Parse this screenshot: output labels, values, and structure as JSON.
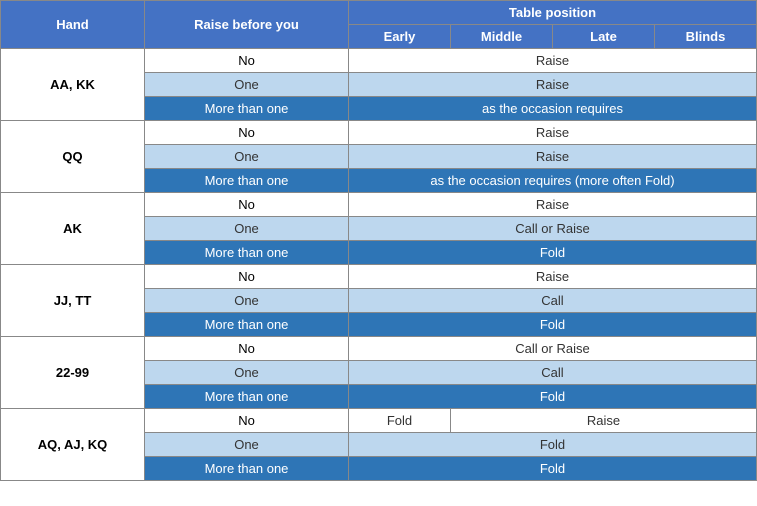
{
  "table": {
    "header": {
      "hand_label": "Hand",
      "raise_label": "Raise before you",
      "table_position": "Table position",
      "early": "Early",
      "middle": "Middle",
      "late": "Late",
      "blinds": "Blinds"
    },
    "rows": [
      {
        "hand": "AA, KK",
        "subrows": [
          {
            "raise": "No",
            "action": "Raise",
            "action_style": "white",
            "colspan": 4,
            "split": false
          },
          {
            "raise": "One",
            "action": "Raise",
            "action_style": "light",
            "colspan": 4,
            "split": false
          },
          {
            "raise": "More than one",
            "raise_style": "dark",
            "action": "as the occasion requires",
            "action_style": "dark",
            "colspan": 4,
            "split": false
          }
        ]
      },
      {
        "hand": "QQ",
        "subrows": [
          {
            "raise": "No",
            "action": "Raise",
            "action_style": "white",
            "colspan": 4,
            "split": false
          },
          {
            "raise": "One",
            "action": "Raise",
            "action_style": "light",
            "colspan": 4,
            "split": false
          },
          {
            "raise": "More than one",
            "raise_style": "dark",
            "action": "as the occasion requires (more often Fold)",
            "action_style": "dark",
            "colspan": 4,
            "split": false
          }
        ]
      },
      {
        "hand": "AK",
        "subrows": [
          {
            "raise": "No",
            "action": "Raise",
            "action_style": "white",
            "colspan": 4,
            "split": false
          },
          {
            "raise": "One",
            "action": "Call or Raise",
            "action_style": "light",
            "colspan": 4,
            "split": false
          },
          {
            "raise": "More than one",
            "raise_style": "dark",
            "action": "Fold",
            "action_style": "dark",
            "colspan": 4,
            "split": false
          }
        ]
      },
      {
        "hand": "JJ, TT",
        "subrows": [
          {
            "raise": "No",
            "action": "Raise",
            "action_style": "white",
            "colspan": 4,
            "split": false
          },
          {
            "raise": "One",
            "action": "Call",
            "action_style": "light",
            "colspan": 4,
            "split": false
          },
          {
            "raise": "More than one",
            "raise_style": "dark",
            "action": "Fold",
            "action_style": "dark",
            "colspan": 4,
            "split": false
          }
        ]
      },
      {
        "hand": "22-99",
        "subrows": [
          {
            "raise": "No",
            "action": "Call or Raise",
            "action_style": "white",
            "colspan": 4,
            "split": false
          },
          {
            "raise": "One",
            "action": "Call",
            "action_style": "light",
            "colspan": 4,
            "split": false
          },
          {
            "raise": "More than one",
            "raise_style": "dark",
            "action": "Fold",
            "action_style": "dark",
            "colspan": 4,
            "split": false
          }
        ]
      },
      {
        "hand": "AQ, AJ, KQ",
        "subrows": [
          {
            "raise": "No",
            "action_split": true,
            "early_action": "Fold",
            "early_style": "white",
            "rest_action": "Raise",
            "rest_style": "white"
          },
          {
            "raise": "One",
            "action": "Fold",
            "action_style": "light",
            "colspan": 4,
            "split": false
          },
          {
            "raise": "More than one",
            "raise_style": "dark",
            "action": "Fold",
            "action_style": "dark",
            "colspan": 4,
            "split": false
          }
        ]
      }
    ]
  }
}
